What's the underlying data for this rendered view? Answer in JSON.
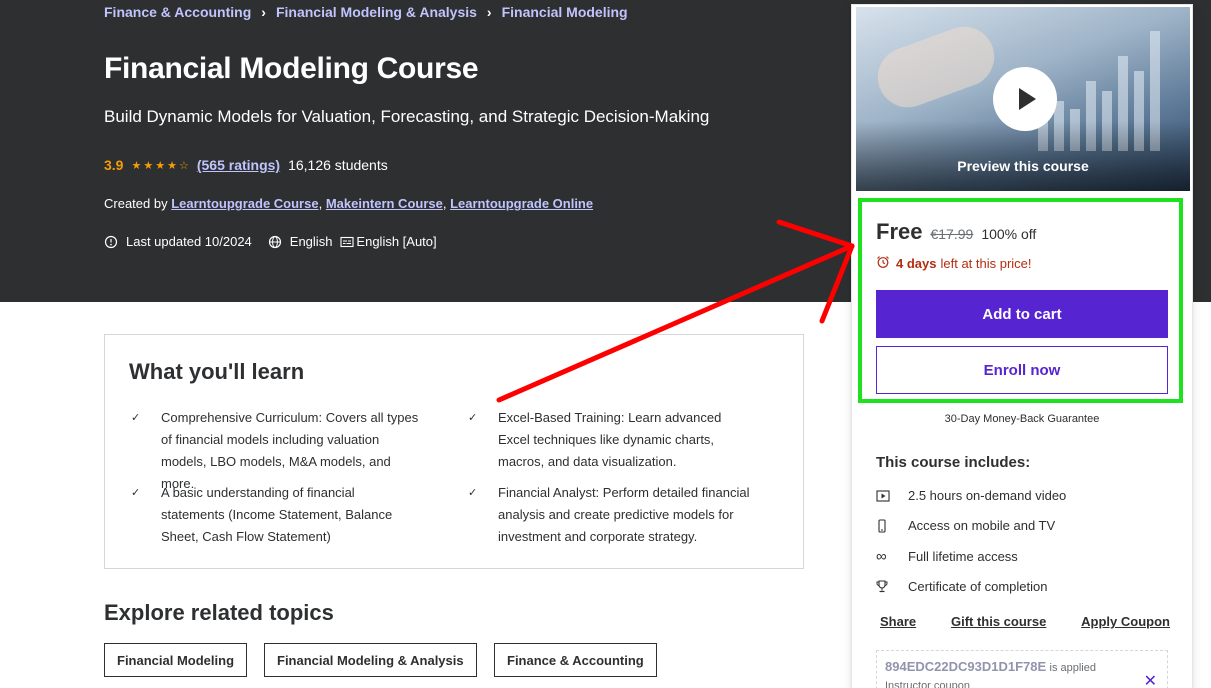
{
  "breadcrumb": [
    "Finance & Accounting",
    "Financial Modeling & Analysis",
    "Financial Modeling"
  ],
  "course": {
    "title": "Financial Modeling Course",
    "subtitle": "Build Dynamic Models for Valuation, Forecasting, and Strategic Decision-Making",
    "rating": "3.9",
    "ratings_count": "(565 ratings)",
    "students": "16,126 students",
    "created_by_label": "Created by",
    "instructors": [
      "Learntoupgrade Course",
      "Makeintern Course",
      "Learntoupgrade Online"
    ],
    "last_updated": "Last updated 10/2024",
    "language": "English",
    "captions": "English [Auto]"
  },
  "learn": {
    "title": "What you'll learn",
    "items": [
      "Comprehensive Curriculum: Covers all types of financial models including valuation models, LBO models, M&A models, and more.",
      "Excel-Based Training: Learn advanced Excel techniques like dynamic charts, macros, and data visualization.",
      "A basic understanding of financial statements (Income Statement, Balance Sheet, Cash Flow Statement)",
      "Financial Analyst: Perform detailed financial analysis and create predictive models for investment and corporate strategy."
    ]
  },
  "related": {
    "title": "Explore related topics",
    "topics": [
      "Financial Modeling",
      "Financial Modeling & Analysis",
      "Finance & Accounting"
    ]
  },
  "sidebar": {
    "preview_label": "Preview this course",
    "price": "Free",
    "original_price": "€17.99",
    "discount": "100% off",
    "timer_bold": "4 days",
    "timer_rest": "left at this price!",
    "add_to_cart": "Add to cart",
    "enroll_now": "Enroll now",
    "guarantee": "30-Day Money-Back Guarantee",
    "includes_title": "This course includes:",
    "includes": [
      {
        "icon": "video-icon",
        "label": "2.5 hours on-demand video"
      },
      {
        "icon": "mobile-icon",
        "label": "Access on mobile and TV"
      },
      {
        "icon": "infinity-icon",
        "label": "Full lifetime access"
      },
      {
        "icon": "trophy-icon",
        "label": "Certificate of completion"
      }
    ],
    "share": "Share",
    "gift": "Gift this course",
    "apply_coupon": "Apply Coupon",
    "coupon_code": "894EDC22DC93D1D1F78E",
    "coupon_text": "is applied",
    "coupon_sub": "Instructor coupon"
  },
  "colors": {
    "accent": "#5624d0",
    "hero_bg": "#2d2f31",
    "rating": "#f69c08",
    "link": "#c0c4fc",
    "timer": "#b32d0f",
    "highlight": "#1ee21e",
    "arrow": "#ff0000"
  }
}
